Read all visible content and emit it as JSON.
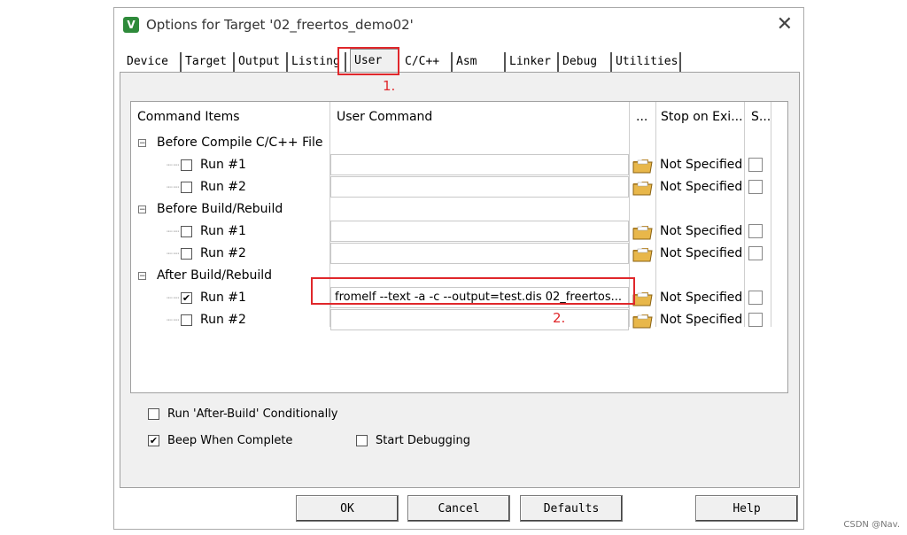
{
  "window": {
    "title": "Options for Target '02_freertos_demo02'",
    "app_icon": "V",
    "close_glyph": "✕"
  },
  "tabs": [
    {
      "label": "Device"
    },
    {
      "label": "Target"
    },
    {
      "label": "Output"
    },
    {
      "label": "Listing"
    },
    {
      "label": "User",
      "active": true
    },
    {
      "label": "C/C++"
    },
    {
      "label": "Asm"
    },
    {
      "label": "Linker"
    },
    {
      "label": "Debug"
    },
    {
      "label": "Utilities"
    }
  ],
  "annotations": {
    "one": "1.",
    "two": "2."
  },
  "grid": {
    "headers": {
      "items": "Command Items",
      "command": "User Command",
      "browse": "...",
      "stop": "Stop on Exi...",
      "s": "S..."
    },
    "groups": [
      {
        "label": "Before Compile C/C++ File",
        "expander": "−"
      },
      {
        "label": "Before Build/Rebuild",
        "expander": "−"
      },
      {
        "label": "After Build/Rebuild",
        "expander": "−"
      }
    ],
    "runs": [
      {
        "label": "Run #1",
        "checked": false,
        "command": "",
        "stop": "Not Specified"
      },
      {
        "label": "Run #2",
        "checked": false,
        "command": "",
        "stop": "Not Specified"
      },
      {
        "label": "Run #1",
        "checked": false,
        "command": "",
        "stop": "Not Specified"
      },
      {
        "label": "Run #2",
        "checked": false,
        "command": "",
        "stop": "Not Specified"
      },
      {
        "label": "Run #1",
        "checked": true,
        "command": "fromelf --text -a -c --output=test.dis 02_freertos...",
        "stop": "Not Specified"
      },
      {
        "label": "Run #2",
        "checked": false,
        "command": "",
        "stop": "Not Specified"
      }
    ]
  },
  "options": {
    "run_after_build": {
      "label": "Run 'After-Build' Conditionally",
      "checked": false
    },
    "beep": {
      "label": "Beep When Complete",
      "checked": true
    },
    "start_debugging": {
      "label": "Start Debugging",
      "checked": false
    }
  },
  "buttons": {
    "ok": "OK",
    "cancel": "Cancel",
    "defaults": "Defaults",
    "help": "Help"
  },
  "watermark": "CSDN @Nav.",
  "colors": {
    "annotation": "#e0272b",
    "folder": "#e8b74a"
  }
}
